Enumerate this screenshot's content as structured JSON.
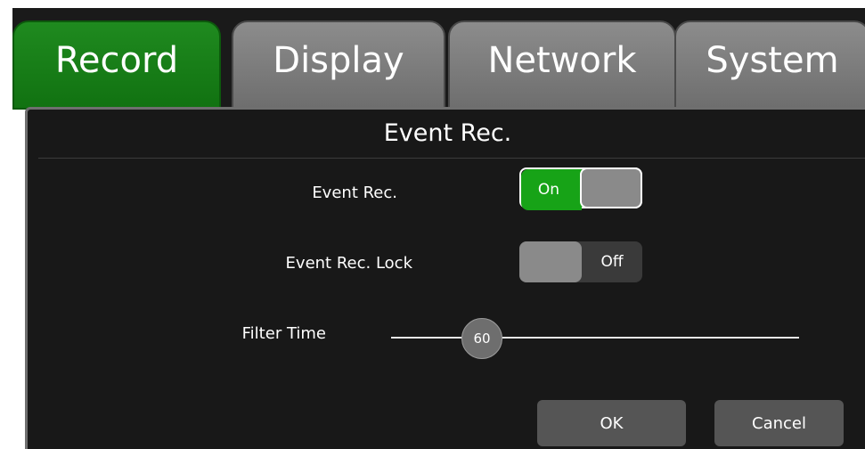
{
  "tabs": [
    {
      "label": "Record",
      "active": true
    },
    {
      "label": "Display",
      "active": false
    },
    {
      "label": "Network",
      "active": false
    },
    {
      "label": "System",
      "active": false
    }
  ],
  "panel": {
    "title": "Event Rec."
  },
  "settings": {
    "event_rec": {
      "label": "Event Rec.",
      "state_text": "On",
      "enabled": true
    },
    "event_rec_lock": {
      "label": "Event Rec. Lock",
      "state_text": "Off",
      "enabled": false
    },
    "filter_time": {
      "label": "Filter Time",
      "value": "60"
    }
  },
  "buttons": {
    "ok": "OK",
    "cancel": "Cancel"
  },
  "colors": {
    "active_tab": "#117211",
    "toggle_on": "#17a317",
    "panel_bg": "#181818"
  }
}
